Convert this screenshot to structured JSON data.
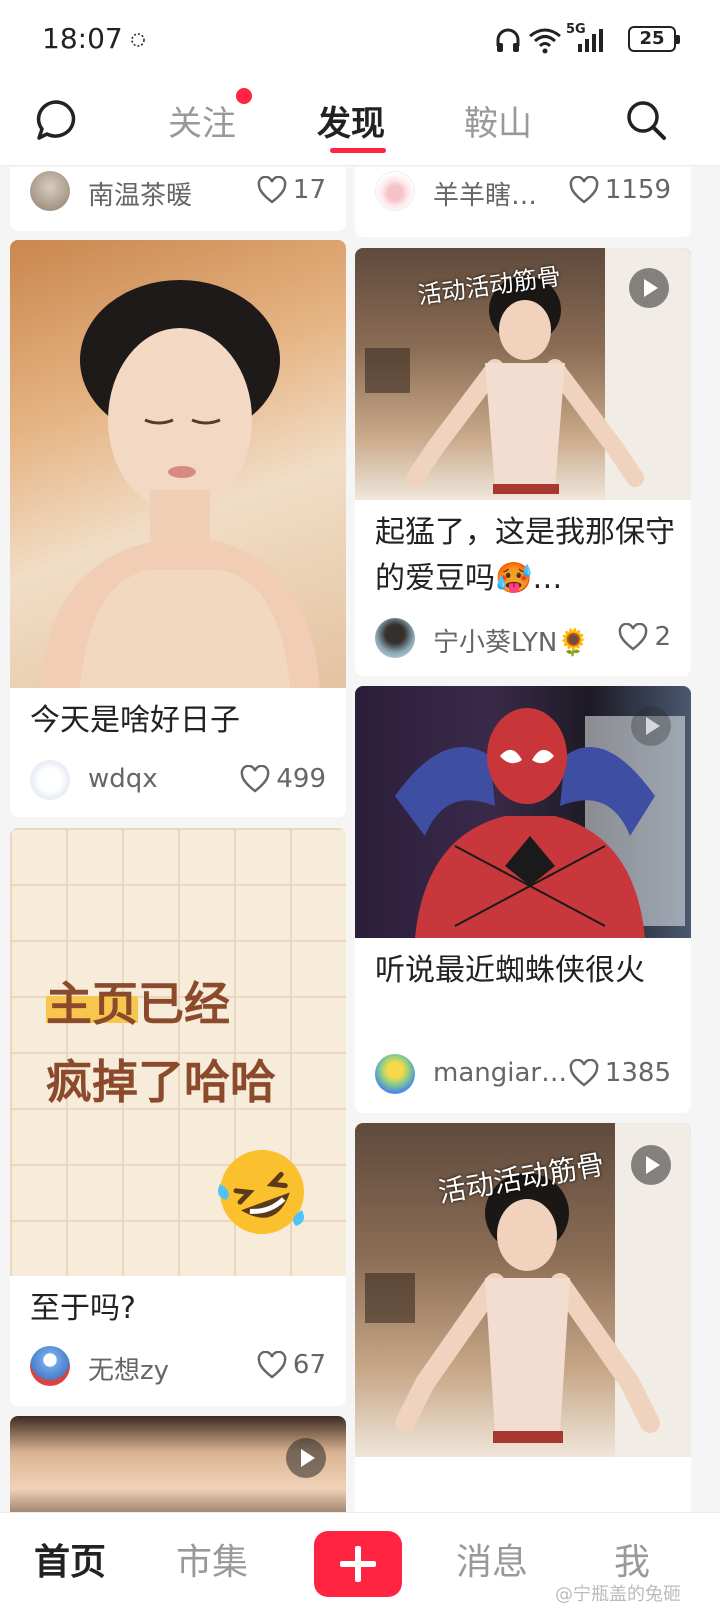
{
  "status_bar": {
    "time": "18:07",
    "network": "5G",
    "battery": "25"
  },
  "nav": {
    "tabs": [
      {
        "label": "关注",
        "active": false,
        "has_dot": true
      },
      {
        "label": "发现",
        "active": true
      },
      {
        "label": "鞍山",
        "active": false
      }
    ],
    "left_icon": "chat-bubble-icon",
    "right_icon": "search-icon"
  },
  "feed": {
    "left": [
      {
        "title": "",
        "author": "南温茶暖",
        "likes": "17"
      },
      {
        "title": "今天是啥好日子",
        "author": "wdqx",
        "likes": "499"
      },
      {
        "title": "至于吗?",
        "author": "无想zy",
        "likes": "67",
        "image_text": {
          "line1_highlight": "主页",
          "line1_rest": "已经",
          "line2": "疯掉了哈哈"
        }
      },
      {
        "title": "",
        "author": "",
        "likes": "",
        "video": true
      }
    ],
    "right": [
      {
        "title": "",
        "author": "羊羊瞎…",
        "likes": "1159"
      },
      {
        "title": "起猛了，这是我那保守的爱豆吗🥵…",
        "author": "宁小葵LYN🌻",
        "likes": "2",
        "video": true,
        "image_text": "活动活动筋骨"
      },
      {
        "title": "听说最近蜘蛛侠很火",
        "author": "mangiar…",
        "likes": "1385",
        "video": true
      },
      {
        "title": "",
        "author": "",
        "likes": "",
        "video": true,
        "image_text": "活动活动筋骨"
      }
    ]
  },
  "bottom_bar": {
    "tabs": [
      {
        "label": "首页",
        "active": true
      },
      {
        "label": "市集",
        "active": false
      },
      {
        "label": "消息",
        "active": false
      },
      {
        "label": "我",
        "active": false
      }
    ],
    "watermark": "@宁瓶盖的兔砸"
  },
  "colors": {
    "accent": "#ff2442",
    "text": "#222222",
    "muted": "#999999"
  }
}
